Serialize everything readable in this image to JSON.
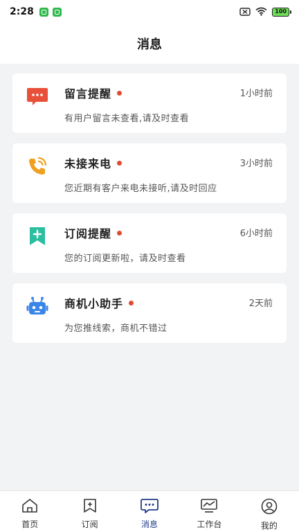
{
  "statusbar": {
    "time": "2:28",
    "battery": "100"
  },
  "header": {
    "title": "消息"
  },
  "messages": [
    {
      "title": "留言提醒",
      "time": "1小时前",
      "desc": "有用户留言未查看,请及时查看",
      "icon": "chat-bubble-icon",
      "color": "#e8503a"
    },
    {
      "title": "未接来电",
      "time": "3小时前",
      "desc": "您近期有客户来电未接听,请及时回应",
      "icon": "phone-call-icon",
      "color": "#f0a020"
    },
    {
      "title": "订阅提醒",
      "time": "6小时前",
      "desc": "您的订阅更新啦，请及时查看",
      "icon": "bookmark-plus-icon",
      "color": "#2bbfa0"
    },
    {
      "title": "商机小助手",
      "time": "2天前",
      "desc": "为您推线索，商机不错过",
      "icon": "robot-icon",
      "color": "#3a86e8"
    }
  ],
  "tabs": [
    {
      "label": "首页",
      "icon": "home-icon",
      "active": false
    },
    {
      "label": "订阅",
      "icon": "subscribe-icon",
      "active": false
    },
    {
      "label": "消息",
      "icon": "message-icon",
      "active": true
    },
    {
      "label": "工作台",
      "icon": "workbench-icon",
      "active": false
    },
    {
      "label": "我的",
      "icon": "profile-icon",
      "active": false
    }
  ],
  "colors": {
    "accent": "#1f3a8a",
    "unread_dot": "#e04a2f",
    "background": "#f2f3f5"
  }
}
